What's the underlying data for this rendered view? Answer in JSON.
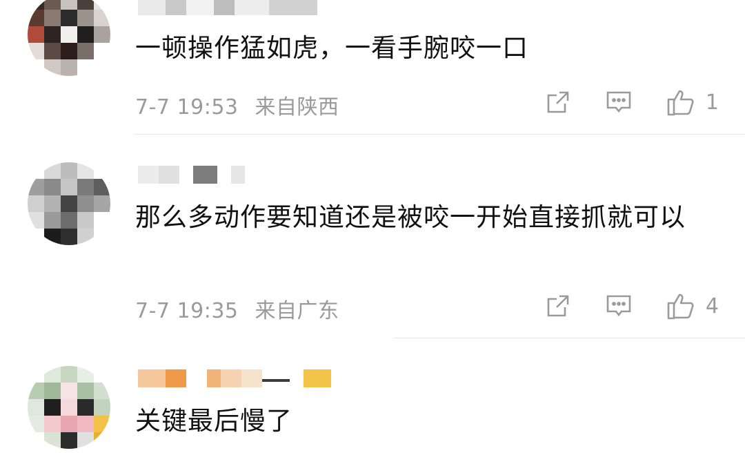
{
  "comments": [
    {
      "text": "一顿操作猛如虎，一看手腕咬一口",
      "timestamp": "7-7 19:53",
      "location": "来自陕西",
      "likes": "1",
      "icons": [
        "share-icon",
        "comment-icon",
        "like-icon"
      ]
    },
    {
      "text": "那么多动作要知道还是被咬一开始直接抓就可以",
      "timestamp": "7-7 19:35",
      "location": "来自广东",
      "likes": "4",
      "icons": [
        "share-icon",
        "comment-icon",
        "like-icon"
      ]
    },
    {
      "text": "关键最后慢了"
    }
  ],
  "colors": {
    "text": "#111111",
    "meta": "#9a9a9a",
    "icon": "#9a9a9a",
    "divider": "#e8e8e8"
  }
}
